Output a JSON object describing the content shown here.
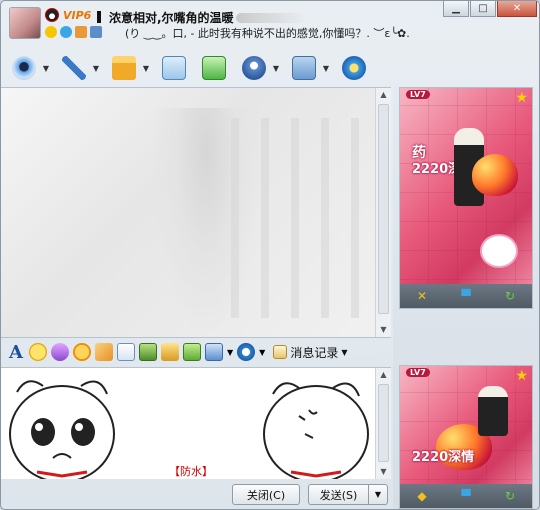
{
  "titlebar": {
    "vip_label": "VIP6",
    "contact_name": "浓意相对,尔嘴角的温暖",
    "status_message": "(り ‿‿。口, - 此时我有种说不出的感觉,你懂吗？. ︶ε╰✿.",
    "minimize_label": "▁",
    "maximize_label": "□",
    "close_label": "✕"
  },
  "toolbar": {
    "items": [
      {
        "icon": "webcam-icon",
        "has_menu": true
      },
      {
        "icon": "microphone-icon",
        "has_menu": true
      },
      {
        "icon": "folder-icon",
        "has_menu": true
      },
      {
        "icon": "email-icon",
        "has_menu": false
      },
      {
        "icon": "add-contact-icon",
        "has_menu": false
      },
      {
        "icon": "tools-icon",
        "has_menu": true
      },
      {
        "icon": "app-settings-icon",
        "has_menu": true
      },
      {
        "icon": "refresh-globe-icon",
        "has_menu": false
      }
    ]
  },
  "format_bar": {
    "font_label": "A",
    "history_label": "消息记录",
    "history_caret": "▼"
  },
  "input": {
    "fang_shui_label": "【防水】"
  },
  "buttons": {
    "close_label": "关闭(C)",
    "send_label": "发送(S)",
    "send_menu_label": "▼"
  },
  "right_panel": {
    "show_top": {
      "level": "LV7",
      "caption_a": "药",
      "caption_b": "2220深情"
    },
    "show_bottom": {
      "level": "LV7",
      "caption_b": "2220深情"
    }
  },
  "colors": {
    "accent": "#1c4f9c",
    "vip": "#e87600",
    "warning_red": "#d40000",
    "pink": "#e85a7c"
  }
}
